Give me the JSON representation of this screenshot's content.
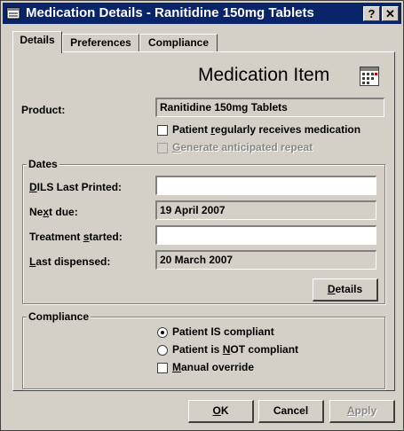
{
  "window": {
    "title": "Medication Details - Ranitidine 150mg Tablets",
    "help_button": "?",
    "close_button": "✕"
  },
  "tabs": [
    {
      "label": "Details",
      "active": true
    },
    {
      "label": "Preferences",
      "active": false
    },
    {
      "label": "Compliance",
      "active": false
    }
  ],
  "header": {
    "heading": "Medication Item",
    "icon": "calendar-grid-icon"
  },
  "product": {
    "label": "Product:",
    "value": "Ranitidine 150mg Tablets"
  },
  "options": {
    "regular_medication": {
      "label_pre": "Patient ",
      "label_u": "r",
      "label_post": "egularly receives medication",
      "checked": false
    },
    "anticipated_repeat": {
      "label_pre": "",
      "label_u": "G",
      "label_post": "enerate anticipated repeat",
      "checked": false,
      "disabled": true
    }
  },
  "dates": {
    "group_title": "Dates",
    "dils_last_printed": {
      "label_u": "D",
      "label_post": "ILS Last Printed:",
      "value": ""
    },
    "next_due": {
      "label_pre": "Ne",
      "label_u": "x",
      "label_post": "t due:",
      "value": "19 April 2007"
    },
    "treatment_started": {
      "label_pre": "Treatment ",
      "label_u": "s",
      "label_post": "tarted:",
      "value": ""
    },
    "last_dispensed": {
      "label_u": "L",
      "label_post": "ast dispensed:",
      "value": "20 March 2007"
    },
    "details_button": {
      "label_u": "D",
      "label_post": "etails"
    }
  },
  "compliance": {
    "group_title": "Compliance",
    "compliant": {
      "label": "Patient IS compliant",
      "selected": true
    },
    "not_compliant": {
      "label_pre": "Patient is ",
      "label_u": "N",
      "label_post": "OT compliant",
      "selected": false
    },
    "manual_override": {
      "label_u": "M",
      "label_post": "anual override",
      "checked": false
    }
  },
  "footer": {
    "ok": {
      "label_u": "O",
      "label_post": "K"
    },
    "cancel": {
      "label": "Cancel"
    },
    "apply": {
      "label_u": "A",
      "label_post": "pply",
      "disabled": true
    }
  }
}
